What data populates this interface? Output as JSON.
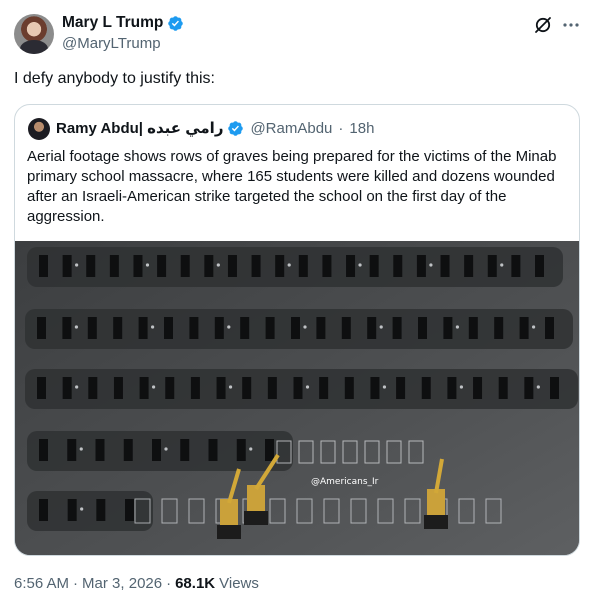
{
  "author": {
    "name": "Mary L Trump",
    "handle": "@MaryLTrump",
    "verified_color": "#1d9bf0"
  },
  "actions": {
    "grok_icon": "grok-slash-icon",
    "more_icon": "more-horizontal-icon"
  },
  "tweet": {
    "text": "I defy anybody to justify this:"
  },
  "quoted": {
    "name": "Ramy Abdu| رامي عبده",
    "handle": "@RamAbdu",
    "separator": "·",
    "age": "18h",
    "text": "Aerial footage shows rows of graves being prepared for the victims of the Minab primary school massacre, where 165 students were killed and dozens wounded after an Israeli-American strike targeted the school on the first day of the aggression.",
    "image_watermark": "@Americans_Ir"
  },
  "footer": {
    "time": "6:56 AM",
    "dot1": "·",
    "date": "Mar 3, 2026",
    "dot2": "·",
    "views_count": "68.1K",
    "views_label": "Views"
  }
}
